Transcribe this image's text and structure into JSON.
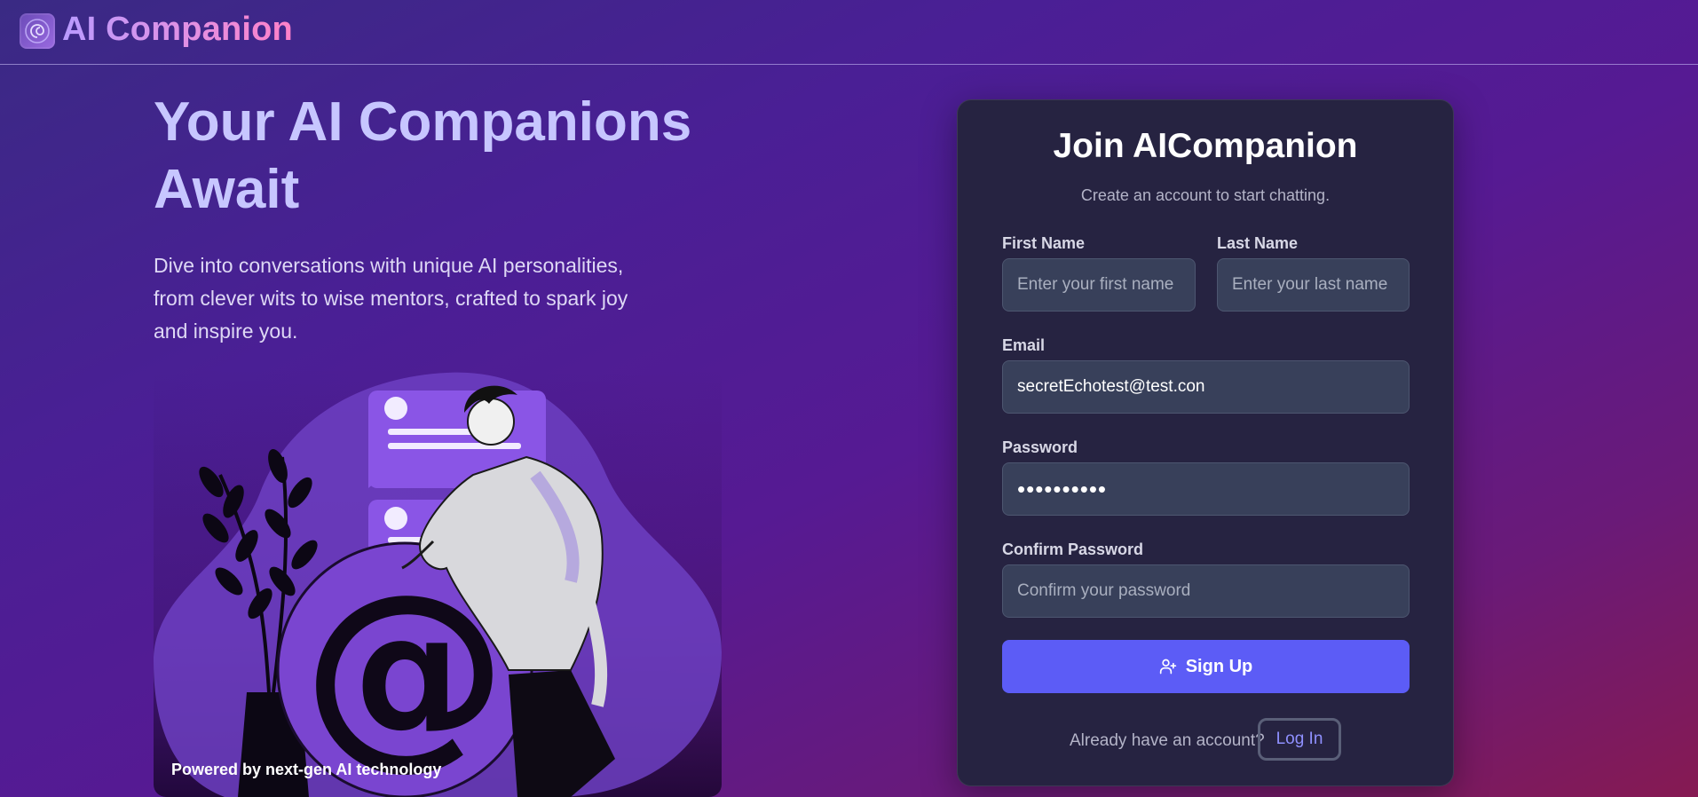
{
  "header": {
    "brand": "AI Companion",
    "logo_icon": "spiral-logo-icon"
  },
  "hero": {
    "title": "Your AI Companions Await",
    "description": "Dive into conversations with unique AI personalities, from clever wits to wise mentors, crafted to spark joy and inspire you.",
    "illustration_caption": "Powered by next-gen AI technology"
  },
  "form": {
    "title": "Join AICompanion",
    "subtitle": "Create an account to start chatting.",
    "first_name": {
      "label": "First Name",
      "placeholder": "Enter your first name",
      "value": ""
    },
    "last_name": {
      "label": "Last Name",
      "placeholder": "Enter your last name",
      "value": ""
    },
    "email": {
      "label": "Email",
      "placeholder": "",
      "value": "secretEchotest@test.con"
    },
    "password": {
      "label": "Password",
      "value": "••••••••••"
    },
    "confirm_password": {
      "label": "Confirm Password",
      "placeholder": "Confirm your password",
      "value": ""
    },
    "signup_label": "Sign Up",
    "signup_icon": "user-plus-icon",
    "already_text": "Already have an account?",
    "login_label": "Log In"
  },
  "colors": {
    "accent": "#5c5cf6",
    "card_bg": "#262341",
    "title_lavender": "#c7c6ff",
    "login_link": "#8f90ff"
  }
}
